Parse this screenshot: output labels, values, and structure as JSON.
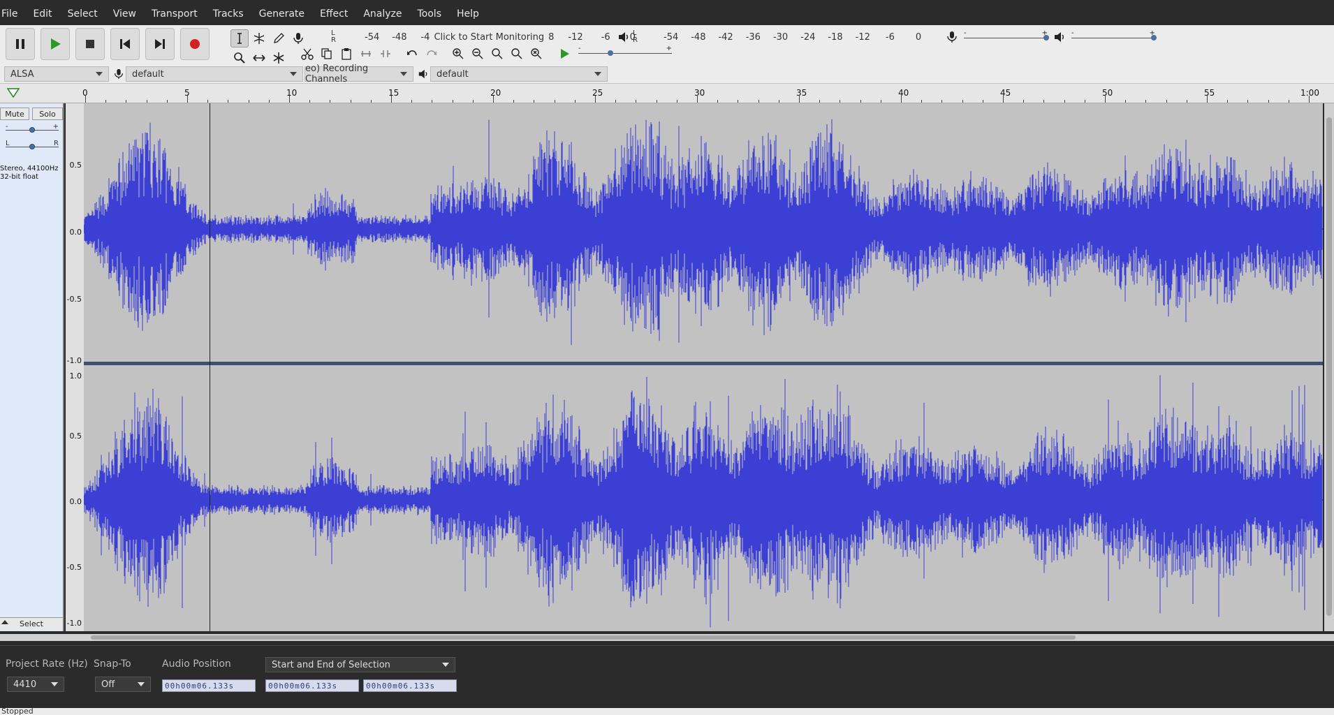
{
  "menu": [
    "File",
    "Edit",
    "Select",
    "View",
    "Transport",
    "Tracks",
    "Generate",
    "Effect",
    "Analyze",
    "Tools",
    "Help"
  ],
  "transport": {
    "pause": "pause-icon",
    "play": "play-icon",
    "stop": "stop-icon",
    "skip_start": "skip-to-start-icon",
    "skip_end": "skip-to-end-icon",
    "record": "record-icon"
  },
  "record_meter": {
    "lr": "L R",
    "ticks": [
      "-54",
      "-48",
      "-4"
    ],
    "monitor": "Click to Start Monitoring",
    "ticks2": [
      "8",
      "-12",
      "-6",
      "0"
    ]
  },
  "playback_meter": {
    "lr": "L R",
    "ticks": [
      "-54",
      "-48",
      "-42",
      "-36",
      "-30",
      "-24",
      "-18",
      "-12",
      "-6",
      "0"
    ]
  },
  "mixer": {
    "minus": "-",
    "plus": "+"
  },
  "device": {
    "host": "ALSA",
    "rec_device": "default",
    "rec_channels": "eo) Recording Channels",
    "play_device": "default"
  },
  "ruler": {
    "labels": [
      "0",
      "5",
      "10",
      "15",
      "20",
      "25",
      "30",
      "35",
      "40",
      "45",
      "50",
      "55",
      "1:00"
    ]
  },
  "track": {
    "mute": "Mute",
    "solo": "Solo",
    "gain_minus": "-",
    "gain_plus": "+",
    "pan_l": "L",
    "pan_r": "R",
    "info_line1": "Stereo, 44100Hz",
    "info_line2": "32-bit float",
    "select": "Select",
    "scale_top": [
      "0.5",
      "0.0",
      "-0.5",
      "-1.0"
    ],
    "scale_bottom": [
      "1.0",
      "0.5",
      "0.0",
      "-0.5",
      "-1.0"
    ]
  },
  "selection_toolbar": {
    "project_rate_label": "Project Rate (Hz)",
    "project_rate_value": "4410",
    "snap_to_label": "Snap-To",
    "snap_to_value": "Off",
    "audio_position_label": "Audio Position",
    "selection_mode": "Start and End of Selection",
    "audio_position": "00h00m06.133s",
    "sel_start": "00h00m06.133s",
    "sel_end": "00h00m06.133s"
  },
  "status": "Stopped",
  "colors": {
    "wave": "#3b3fd4",
    "wave_bg": "#c2c2c2",
    "accent": "#cc2222"
  }
}
